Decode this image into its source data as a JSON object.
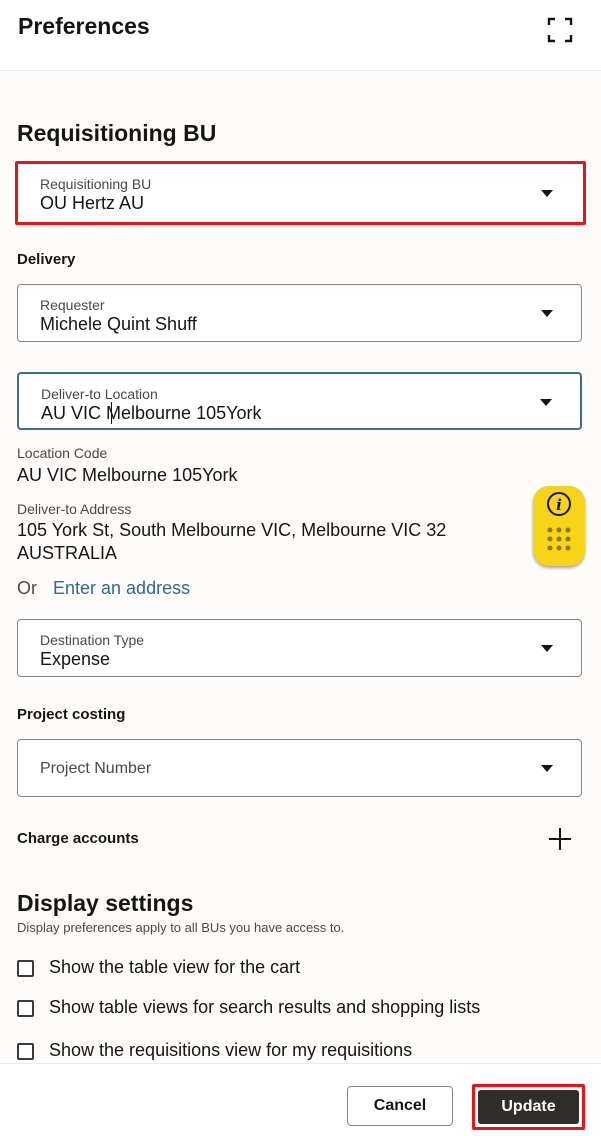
{
  "header": {
    "title": "Preferences",
    "expand_icon": "expand-icon"
  },
  "requisitioning": {
    "section_title": "Requisitioning BU",
    "bu_field": {
      "label": "Requisitioning BU",
      "value": "OU Hertz AU"
    }
  },
  "delivery": {
    "section_title": "Delivery",
    "requester": {
      "label": "Requester",
      "value": "Michele Quint Shuff"
    },
    "deliver_to": {
      "label": "Deliver-to Location",
      "value": "AU VIC Melbourne 105York"
    },
    "location_code_label": "Location Code",
    "location_code_value": "AU VIC Melbourne 105York",
    "address_label": "Deliver-to Address",
    "address_line1": "105 York St, South Melbourne VIC, Melbourne VIC 32",
    "address_line2": "AUSTRALIA",
    "or_text": "Or",
    "enter_address_link": "Enter an address",
    "destination_type": {
      "label": "Destination Type",
      "value": "Expense"
    }
  },
  "project_costing": {
    "section_title": "Project costing",
    "project_number_placeholder": "Project Number"
  },
  "charge_accounts": {
    "label": "Charge accounts",
    "add_icon": "plus-icon"
  },
  "display_settings": {
    "section_title": "Display settings",
    "help_text": "Display preferences apply to all BUs you have access to.",
    "options": [
      {
        "label": "Show the table view for the cart",
        "checked": false
      },
      {
        "label": "Show table views for search results and shopping lists",
        "checked": false
      },
      {
        "label": "Show the requisitions view for my requisitions",
        "checked": false
      }
    ]
  },
  "helper_widget": {
    "icon": "info-icon",
    "color": "#f7d417"
  },
  "footer": {
    "cancel_label": "Cancel",
    "update_label": "Update"
  },
  "colors": {
    "highlight": "#e3141b",
    "link": "#2b6b8f",
    "primary_button": "#312d2a",
    "focus_border": "#3c6f97"
  }
}
